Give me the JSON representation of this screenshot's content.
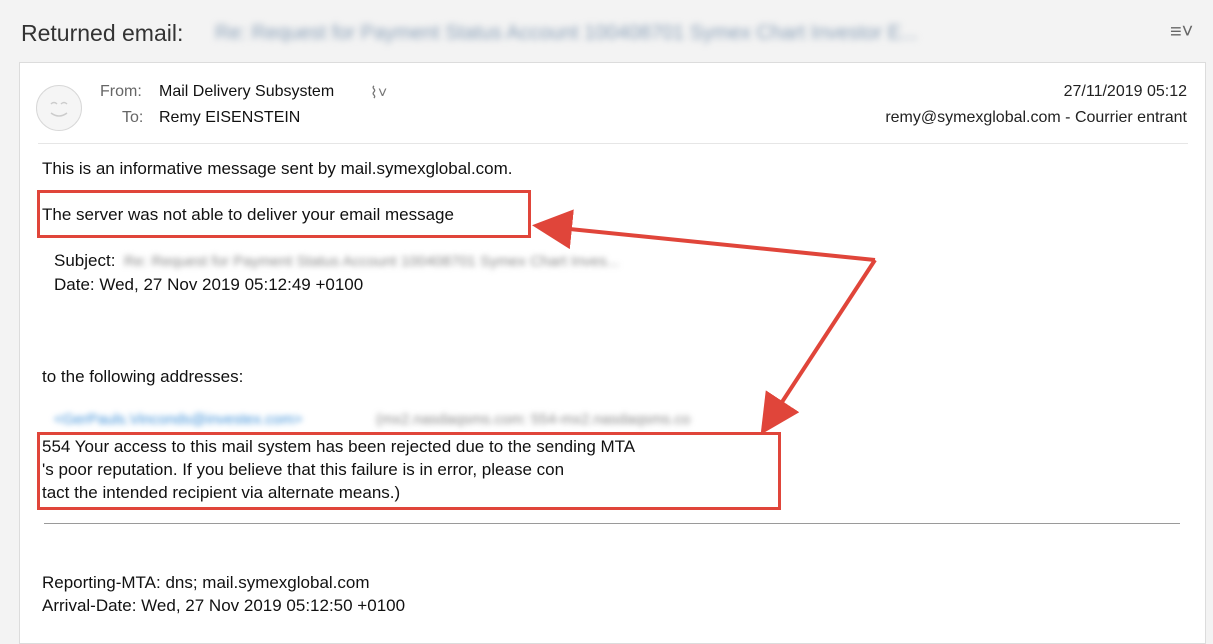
{
  "header": {
    "title_label": "Returned email:",
    "subject_blurred": "Re: Request for Payment Status Account 100408701 Symex Chart Investor E...",
    "menu_icon": "list-menu-icon"
  },
  "message": {
    "from_label": "From:",
    "from_value": "Mail Delivery Subsystem",
    "to_label": "To:",
    "to_value": "Remy EISENSTEIN",
    "date": "27/11/2019 05:12",
    "mailbox": "remy@symexglobal.com - Courrier entrant"
  },
  "body": {
    "intro": "This is an informative message sent by mail.symexglobal.com.",
    "not_delivered": "The server was not able to deliver your email message",
    "subject_label": "Subject:",
    "subject_blurred": "Re: Request for Payment Status Account 100408701 Symex Chart Inves...",
    "date_line": "Date: Wed, 27 Nov 2019 05:12:49 +0100",
    "following": "to the following addresses:",
    "address_blurred": "<GerPauls.Vinconds@investex.com>",
    "address_detail_blurred": "(mx2.nasdaqsms.com: 554-mx2.nasdaqsms.co",
    "error_line1": "554 Your access to this mail system has been rejected due to the sending MTA",
    "error_line2": "'s poor reputation. If you believe that this failure is in error, please con",
    "error_line3": "tact the intended recipient via alternate means.)",
    "reporting_mta": "Reporting-MTA: dns; mail.symexglobal.com",
    "arrival_date": "Arrival-Date: Wed, 27 Nov 2019 05:12:50 +0100"
  },
  "colors": {
    "highlight": "#e0453a",
    "link_blue": "#3b8fd8",
    "background": "#f3f3f3"
  }
}
